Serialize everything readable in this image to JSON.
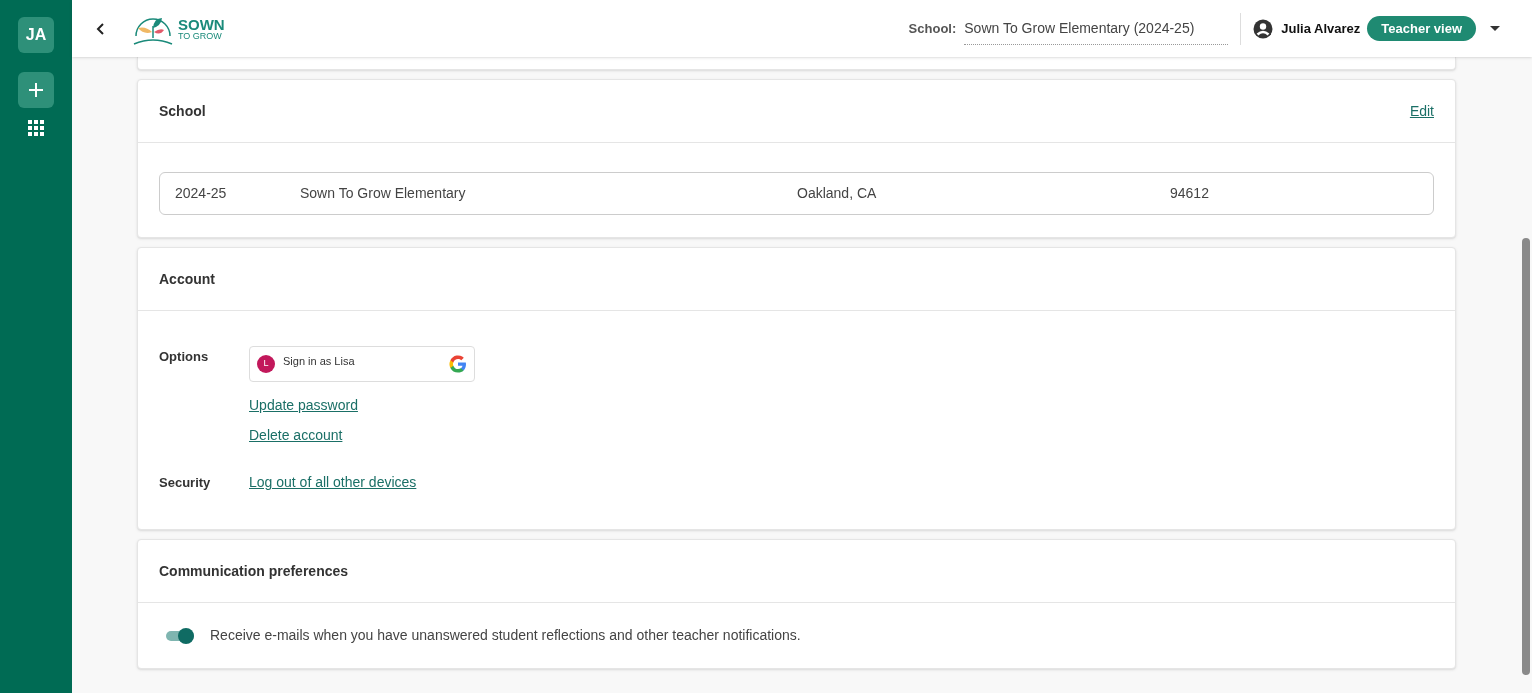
{
  "sidebar": {
    "avatar": "JA"
  },
  "header": {
    "logo_line_1": "SOWN",
    "logo_line_2": "TO GROW",
    "school_label": "School:",
    "school_value": "Sown To Grow Elementary (2024-25)",
    "user_name": "Julia Alvarez",
    "role": "Teacher view"
  },
  "school_section": {
    "title": "School",
    "edit": "Edit",
    "row": [
      "2024-25",
      "Sown To Grow Elementary",
      "Oakland, CA",
      "94612"
    ]
  },
  "account_section": {
    "title": "Account",
    "groups": [
      {
        "label": "Options",
        "items": [
          {
            "kind": "google",
            "avatar": "L",
            "text": "Sign in as Lisa"
          },
          {
            "kind": "link",
            "text": "Update password"
          },
          {
            "kind": "link",
            "text": "Delete account"
          }
        ]
      },
      {
        "label": "Security",
        "items": [
          {
            "kind": "link",
            "text": "Log out of all other devices"
          }
        ]
      }
    ]
  },
  "communication_section": {
    "title": "Communication preferences",
    "preferences": [
      {
        "on": true,
        "text": "Receive e-mails when you have unanswered student reflections and other teacher notifications."
      }
    ]
  }
}
